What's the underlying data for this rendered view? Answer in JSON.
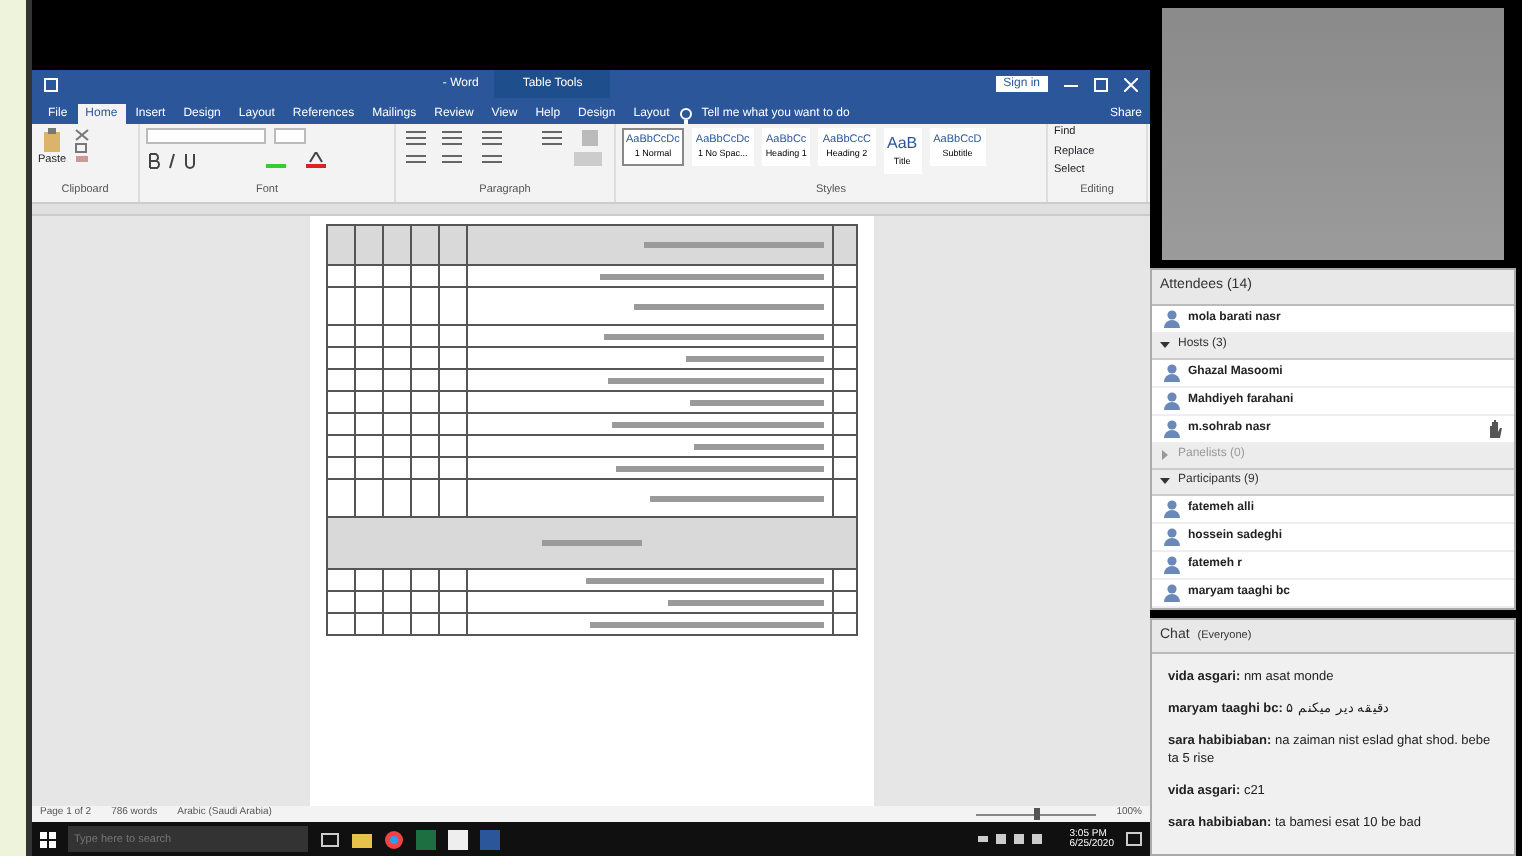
{
  "shared_screen": {
    "word": {
      "title": "- Word",
      "context_tab": "Table Tools",
      "sign_in": "Sign in",
      "tabs": [
        {
          "label": "File",
          "selected": false
        },
        {
          "label": "Home",
          "selected": true
        },
        {
          "label": "Insert",
          "selected": false
        },
        {
          "label": "Design",
          "selected": false
        },
        {
          "label": "Layout",
          "selected": false
        },
        {
          "label": "References",
          "selected": false
        },
        {
          "label": "Mailings",
          "selected": false
        },
        {
          "label": "Review",
          "selected": false
        },
        {
          "label": "View",
          "selected": false
        },
        {
          "label": "Help",
          "selected": false
        },
        {
          "label": "Design",
          "selected": false
        },
        {
          "label": "Layout",
          "selected": false
        }
      ],
      "tell_me": "Tell me what you want to do",
      "share": "Share",
      "paste": "Paste",
      "styles": [
        {
          "sample": "AaBbCcDc",
          "name": "1 Normal",
          "selected": true
        },
        {
          "sample": "AaBbCcDc",
          "name": "1 No Spac...",
          "selected": false
        },
        {
          "sample": "AaBbCc",
          "name": "Heading 1",
          "selected": false
        },
        {
          "sample": "AaBbCcC",
          "name": "Heading 2",
          "selected": false
        },
        {
          "sample": "AaB",
          "name": "Title",
          "selected": false
        },
        {
          "sample": "AaBbCcD",
          "name": "Subtitle",
          "selected": false
        }
      ],
      "editing": [
        "Find",
        "Replace",
        "Select"
      ],
      "groups": [
        "Clipboard",
        "Font",
        "Paragraph",
        "Styles",
        "Editing"
      ],
      "status": [
        "Page 1 of 2",
        "786 words",
        "Arabic (Saudi Arabia)"
      ],
      "zoom_slider": {
        "level": 0.5
      },
      "zoom": "100%"
    },
    "taskbar": {
      "search_placeholder": "Type here to search",
      "time": "3:05 PM",
      "date": "6/25/2020"
    }
  },
  "attendees": {
    "title": "Attendees (14)",
    "me": "mola barati nasr",
    "groups": [
      {
        "label": "Hosts (3)",
        "expanded": true,
        "people": [
          {
            "name": "Ghazal Masoomi",
            "hand_raised": false
          },
          {
            "name": "Mahdiyeh farahani",
            "hand_raised": false
          },
          {
            "name": "m.sohrab nasr",
            "hand_raised": true
          }
        ]
      },
      {
        "label": "Panelists (0)",
        "expanded": false
      },
      {
        "label": "Participants (9)",
        "expanded": true,
        "people": [
          {
            "name": "fatemeh alli",
            "hand_raised": false
          },
          {
            "name": "hossein sadeghi",
            "hand_raised": false
          },
          {
            "name": "fatemeh r",
            "hand_raised": false
          },
          {
            "name": "maryam taaghi bc",
            "hand_raised": false
          }
        ]
      }
    ]
  },
  "chat": {
    "title": "Chat",
    "audience": "(Everyone)",
    "messages": [
      {
        "sender": "vida asgari:",
        "text": "nm asat monde"
      },
      {
        "sender": "maryam taaghi bc:",
        "text": "۵ دقیقه دیر میکنم"
      },
      {
        "sender": "sara habibiaban:",
        "text": "na zaiman nist eslad ghat shod. bebe ta 5 rise"
      },
      {
        "sender": "vida asgari:",
        "text": "c21"
      },
      {
        "sender": "sara habibiaban:",
        "text": "ta bamesi esat 10 be bad"
      }
    ]
  }
}
